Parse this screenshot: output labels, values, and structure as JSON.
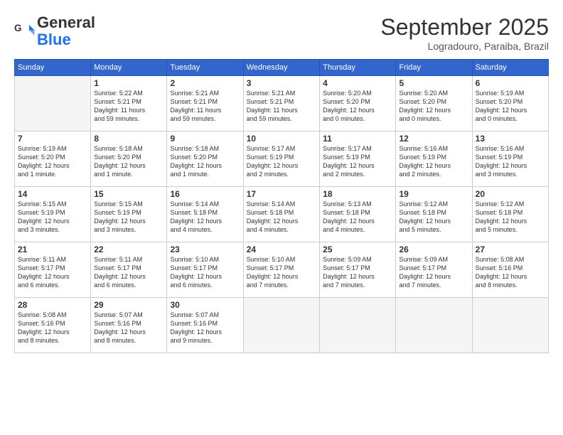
{
  "header": {
    "logo_line1": "General",
    "logo_line2": "Blue",
    "month": "September 2025",
    "location": "Logradouro, Paraiba, Brazil"
  },
  "days_of_week": [
    "Sunday",
    "Monday",
    "Tuesday",
    "Wednesday",
    "Thursday",
    "Friday",
    "Saturday"
  ],
  "weeks": [
    [
      {
        "day": "",
        "info": ""
      },
      {
        "day": "1",
        "info": "Sunrise: 5:22 AM\nSunset: 5:21 PM\nDaylight: 11 hours\nand 59 minutes."
      },
      {
        "day": "2",
        "info": "Sunrise: 5:21 AM\nSunset: 5:21 PM\nDaylight: 11 hours\nand 59 minutes."
      },
      {
        "day": "3",
        "info": "Sunrise: 5:21 AM\nSunset: 5:21 PM\nDaylight: 11 hours\nand 59 minutes."
      },
      {
        "day": "4",
        "info": "Sunrise: 5:20 AM\nSunset: 5:20 PM\nDaylight: 12 hours\nand 0 minutes."
      },
      {
        "day": "5",
        "info": "Sunrise: 5:20 AM\nSunset: 5:20 PM\nDaylight: 12 hours\nand 0 minutes."
      },
      {
        "day": "6",
        "info": "Sunrise: 5:19 AM\nSunset: 5:20 PM\nDaylight: 12 hours\nand 0 minutes."
      }
    ],
    [
      {
        "day": "7",
        "info": "Sunrise: 5:19 AM\nSunset: 5:20 PM\nDaylight: 12 hours\nand 1 minute."
      },
      {
        "day": "8",
        "info": "Sunrise: 5:18 AM\nSunset: 5:20 PM\nDaylight: 12 hours\nand 1 minute."
      },
      {
        "day": "9",
        "info": "Sunrise: 5:18 AM\nSunset: 5:20 PM\nDaylight: 12 hours\nand 1 minute."
      },
      {
        "day": "10",
        "info": "Sunrise: 5:17 AM\nSunset: 5:19 PM\nDaylight: 12 hours\nand 2 minutes."
      },
      {
        "day": "11",
        "info": "Sunrise: 5:17 AM\nSunset: 5:19 PM\nDaylight: 12 hours\nand 2 minutes."
      },
      {
        "day": "12",
        "info": "Sunrise: 5:16 AM\nSunset: 5:19 PM\nDaylight: 12 hours\nand 2 minutes."
      },
      {
        "day": "13",
        "info": "Sunrise: 5:16 AM\nSunset: 5:19 PM\nDaylight: 12 hours\nand 3 minutes."
      }
    ],
    [
      {
        "day": "14",
        "info": "Sunrise: 5:15 AM\nSunset: 5:19 PM\nDaylight: 12 hours\nand 3 minutes."
      },
      {
        "day": "15",
        "info": "Sunrise: 5:15 AM\nSunset: 5:19 PM\nDaylight: 12 hours\nand 3 minutes."
      },
      {
        "day": "16",
        "info": "Sunrise: 5:14 AM\nSunset: 5:18 PM\nDaylight: 12 hours\nand 4 minutes."
      },
      {
        "day": "17",
        "info": "Sunrise: 5:14 AM\nSunset: 5:18 PM\nDaylight: 12 hours\nand 4 minutes."
      },
      {
        "day": "18",
        "info": "Sunrise: 5:13 AM\nSunset: 5:18 PM\nDaylight: 12 hours\nand 4 minutes."
      },
      {
        "day": "19",
        "info": "Sunrise: 5:12 AM\nSunset: 5:18 PM\nDaylight: 12 hours\nand 5 minutes."
      },
      {
        "day": "20",
        "info": "Sunrise: 5:12 AM\nSunset: 5:18 PM\nDaylight: 12 hours\nand 5 minutes."
      }
    ],
    [
      {
        "day": "21",
        "info": "Sunrise: 5:11 AM\nSunset: 5:17 PM\nDaylight: 12 hours\nand 6 minutes."
      },
      {
        "day": "22",
        "info": "Sunrise: 5:11 AM\nSunset: 5:17 PM\nDaylight: 12 hours\nand 6 minutes."
      },
      {
        "day": "23",
        "info": "Sunrise: 5:10 AM\nSunset: 5:17 PM\nDaylight: 12 hours\nand 6 minutes."
      },
      {
        "day": "24",
        "info": "Sunrise: 5:10 AM\nSunset: 5:17 PM\nDaylight: 12 hours\nand 7 minutes."
      },
      {
        "day": "25",
        "info": "Sunrise: 5:09 AM\nSunset: 5:17 PM\nDaylight: 12 hours\nand 7 minutes."
      },
      {
        "day": "26",
        "info": "Sunrise: 5:09 AM\nSunset: 5:17 PM\nDaylight: 12 hours\nand 7 minutes."
      },
      {
        "day": "27",
        "info": "Sunrise: 5:08 AM\nSunset: 5:16 PM\nDaylight: 12 hours\nand 8 minutes."
      }
    ],
    [
      {
        "day": "28",
        "info": "Sunrise: 5:08 AM\nSunset: 5:16 PM\nDaylight: 12 hours\nand 8 minutes."
      },
      {
        "day": "29",
        "info": "Sunrise: 5:07 AM\nSunset: 5:16 PM\nDaylight: 12 hours\nand 8 minutes."
      },
      {
        "day": "30",
        "info": "Sunrise: 5:07 AM\nSunset: 5:16 PM\nDaylight: 12 hours\nand 9 minutes."
      },
      {
        "day": "",
        "info": ""
      },
      {
        "day": "",
        "info": ""
      },
      {
        "day": "",
        "info": ""
      },
      {
        "day": "",
        "info": ""
      }
    ]
  ]
}
